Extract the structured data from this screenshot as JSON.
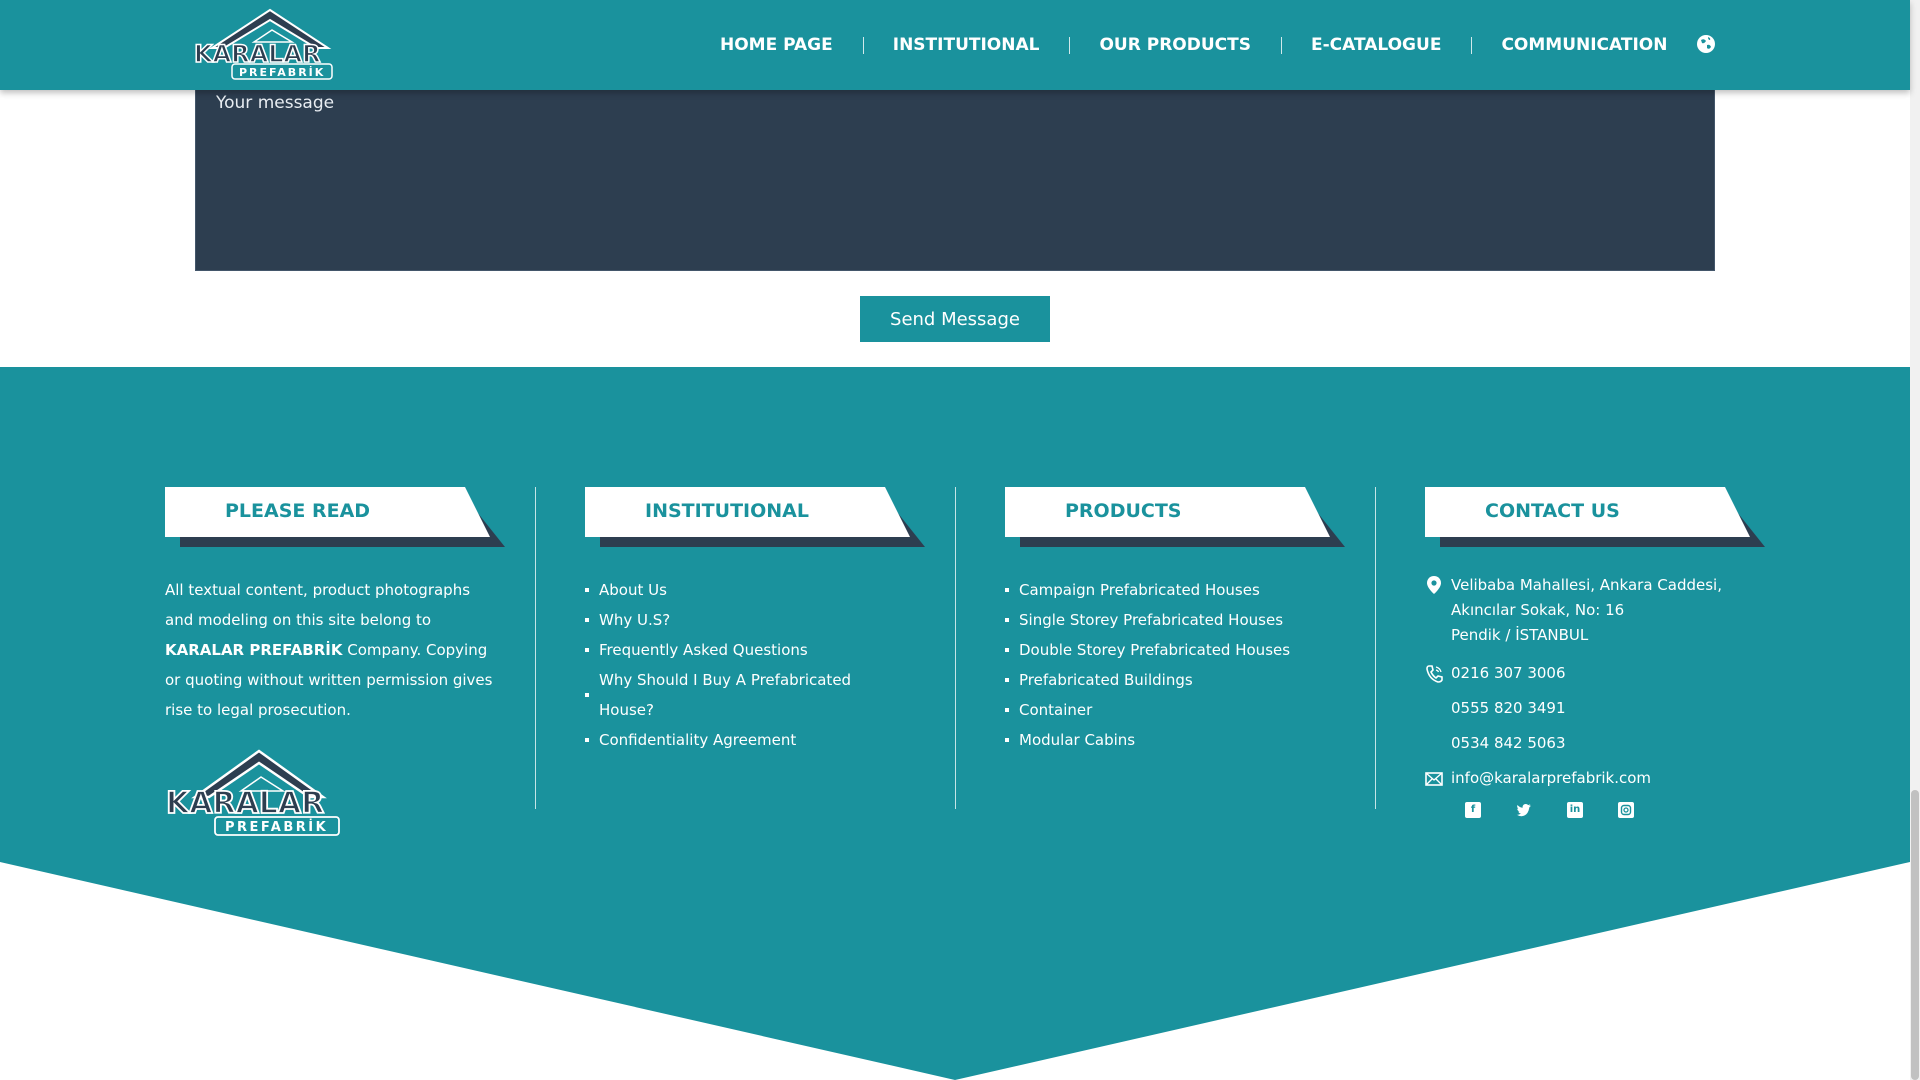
{
  "header": {
    "logo_top": "KARALAR",
    "logo_bottom": "PREFABRİK",
    "nav": [
      {
        "label": "HOME PAGE"
      },
      {
        "label": "INSTITUTIONAL"
      },
      {
        "label": "OUR PRODUCTS"
      },
      {
        "label": "E-CATALOGUE"
      },
      {
        "label": "COMMUNICATION"
      }
    ],
    "language_icon": "globe-icon"
  },
  "form": {
    "message_placeholder": "Your message",
    "message_value": "",
    "send_label": "Send Message"
  },
  "footer": {
    "please_read": {
      "title": "PLEASE READ",
      "text_before": "All textual content, product photographs and modeling on this site belong to ",
      "brand": "KARALAR PREFABRİK",
      "text_after": " Company. Copying or quoting without written permission gives rise to legal prosecution."
    },
    "institutional": {
      "title": "INSTITUTIONAL",
      "items": [
        "About Us",
        "Why U.S?",
        "Frequently Asked Questions",
        "Why Should I Buy A Prefabricated House?",
        "Confidentiality Agreement"
      ]
    },
    "products": {
      "title": "PRODUCTS",
      "items": [
        "Campaign Prefabricated Houses",
        "Single Storey Prefabricated Houses",
        "Double Storey Prefabricated Houses",
        "Prefabricated Buildings",
        "Container",
        "Modular Cabins"
      ]
    },
    "contact": {
      "title": "CONTACT US",
      "address_1": "Velibaba Mahallesi, Ankara Caddesi,",
      "address_2": "Akıncılar Sokak, No: 16",
      "address_3": "Pendik / İSTANBUL",
      "phones": [
        "0216 307 3006",
        "0555 820 3491",
        "0534 842 5063"
      ],
      "email": "info@karalarprefabrik.com",
      "socials": [
        "facebook-icon",
        "twitter-icon",
        "linkedin-icon",
        "instagram-icon"
      ]
    }
  },
  "colors": {
    "teal": "#1a929d",
    "navy": "#2d3e50",
    "white": "#ffffff"
  }
}
